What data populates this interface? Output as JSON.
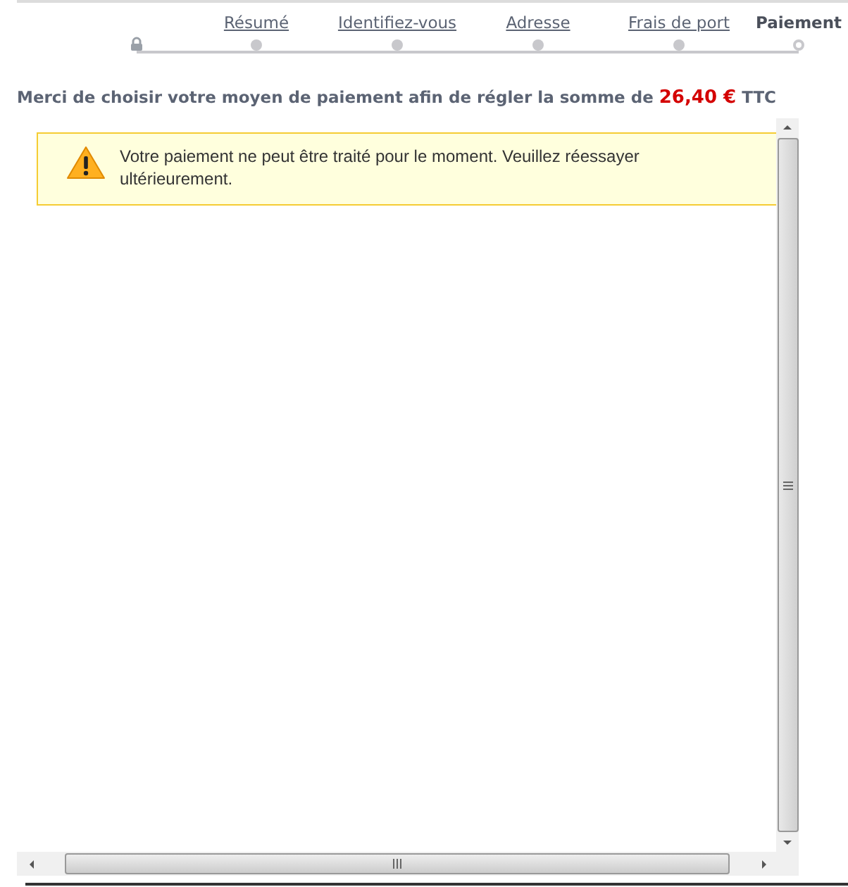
{
  "steps": [
    {
      "label": "Résumé",
      "selected": false
    },
    {
      "label": "Identifiez-vous",
      "selected": false
    },
    {
      "label": "Adresse",
      "selected": false
    },
    {
      "label": "Frais de port",
      "selected": false
    },
    {
      "label": "Paiement",
      "selected": true
    }
  ],
  "intro": {
    "text": "Merci de choisir votre moyen de paiement afin de régler la somme de",
    "amount": "26,40 €",
    "suffix": "TTC"
  },
  "alert": {
    "kind": "warning",
    "message": "Votre paiement ne peut être traité pour le moment. Veuillez réessayer ultérieurement."
  }
}
